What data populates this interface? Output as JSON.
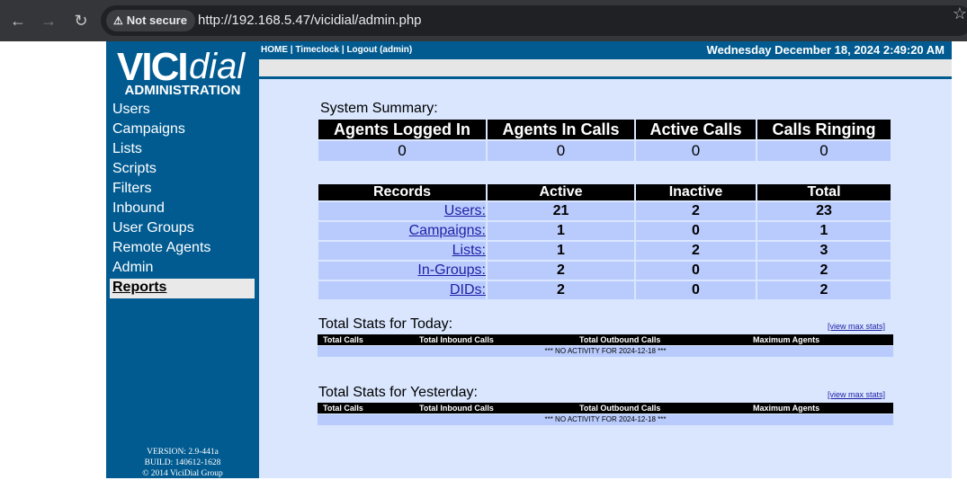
{
  "browser": {
    "security_label": "Not secure",
    "url": "http://192.168.5.47/vicidial/admin.php"
  },
  "sidebar": {
    "logo_vici": "VICI",
    "logo_dial": "dial",
    "admin_title": "ADMINISTRATION",
    "items": [
      {
        "label": "Users"
      },
      {
        "label": "Campaigns"
      },
      {
        "label": "Lists"
      },
      {
        "label": "Scripts"
      },
      {
        "label": "Filters"
      },
      {
        "label": "Inbound"
      },
      {
        "label": "User Groups"
      },
      {
        "label": "Remote Agents"
      },
      {
        "label": "Admin"
      },
      {
        "label": "Reports"
      }
    ],
    "version": "VERSION: 2.9-441a",
    "build": "BUILD: 140612-1628",
    "copyright": "© 2014 ViciDial Group"
  },
  "topbar": {
    "home": "HOME",
    "sep1": " | ",
    "timeclock": "Timeclock",
    "sep2": " | ",
    "logout": "Logout (admin)",
    "datetime": "Wednesday December 18, 2024 2:49:20 AM"
  },
  "summary": {
    "heading": "System Summary:",
    "headers": [
      "Agents Logged In",
      "Agents In Calls",
      "Active Calls",
      "Calls Ringing"
    ],
    "values": [
      "0",
      "0",
      "0",
      "0"
    ]
  },
  "records": {
    "headers": [
      "Records",
      "Active",
      "Inactive",
      "Total"
    ],
    "rows": [
      {
        "name": "Users:",
        "active": "21",
        "inactive": "2",
        "total": "23"
      },
      {
        "name": "Campaigns:",
        "active": "1",
        "inactive": "0",
        "total": "1"
      },
      {
        "name": "Lists:",
        "active": "1",
        "inactive": "2",
        "total": "3"
      },
      {
        "name": "In-Groups:",
        "active": "2",
        "inactive": "0",
        "total": "2"
      },
      {
        "name": "DIDs:",
        "active": "2",
        "inactive": "0",
        "total": "2"
      }
    ]
  },
  "today": {
    "heading": "Total Stats for Today:",
    "max_link": "[view max stats]",
    "headers": [
      "Total Calls",
      "Total Inbound Calls",
      "Total Outbound Calls",
      "Maximum Agents"
    ],
    "message": "*** NO ACTIVITY FOR 2024-12-18 ***"
  },
  "yesterday": {
    "heading": "Total Stats for Yesterday:",
    "max_link": "[view max stats]",
    "headers": [
      "Total Calls",
      "Total Inbound Calls",
      "Total Outbound Calls",
      "Maximum Agents"
    ],
    "message": "*** NO ACTIVITY FOR 2024-12-18 ***"
  }
}
